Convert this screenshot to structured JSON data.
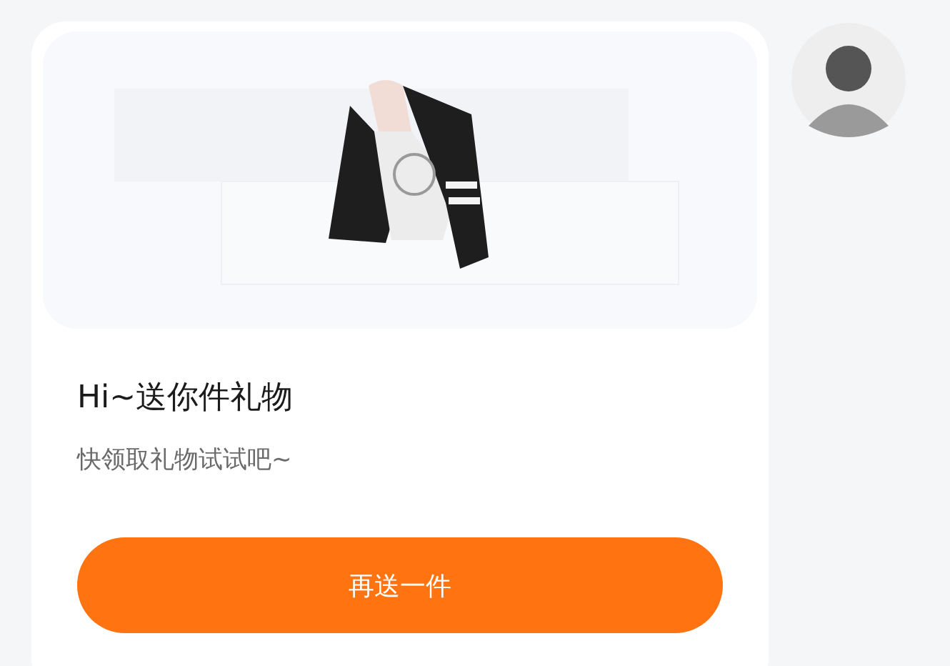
{
  "card": {
    "title": "Hi~送你件礼物",
    "subtitle": "快领取礼物试试吧~",
    "button": "再送一件"
  },
  "avatar": {
    "kind": "avatar"
  }
}
